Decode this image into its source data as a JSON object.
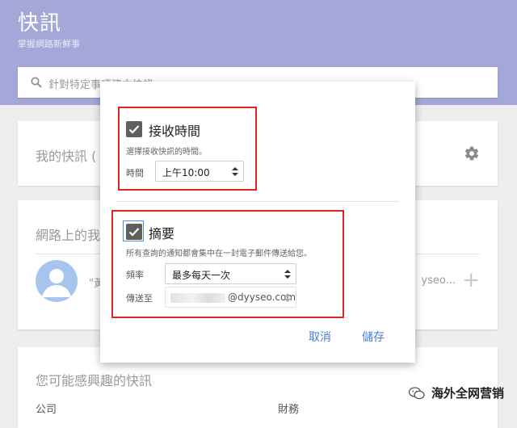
{
  "header": {
    "title": "快訊",
    "subtitle": "掌握網路新鮮事",
    "search_placeholder": "針對特定事項建立快訊"
  },
  "cards": {
    "my_alerts_title": "我的快訊 (",
    "web_alerts_title": "網路上的我",
    "web_alerts_item_text": "\"黃",
    "web_alerts_right_text": "yseo...",
    "suggested_title": "您可能感興趣的快訊",
    "suggested_col_left": "公司",
    "suggested_col_right": "財務"
  },
  "dialog": {
    "delivery_time": {
      "checked": true,
      "title": "接收時間",
      "description": "選擇接收快訊的時間。",
      "label": "時間",
      "value": "上午10:00"
    },
    "digest": {
      "checked": true,
      "title": "摘要",
      "description": "所有查詢的通知都會集中在一封電子郵件傳送給您。",
      "frequency_label": "頻率",
      "frequency_value": "最多每天一次",
      "send_to_label": "傳送至",
      "send_to_value": "@dyyseo.com"
    },
    "cancel_label": "取消",
    "save_label": "儲存"
  },
  "watermark": {
    "text": "海外全网营销"
  },
  "colors": {
    "header_bg": "#a4a8d8",
    "accent_blue": "#4a7fd4",
    "highlight_red": "#e02424"
  }
}
